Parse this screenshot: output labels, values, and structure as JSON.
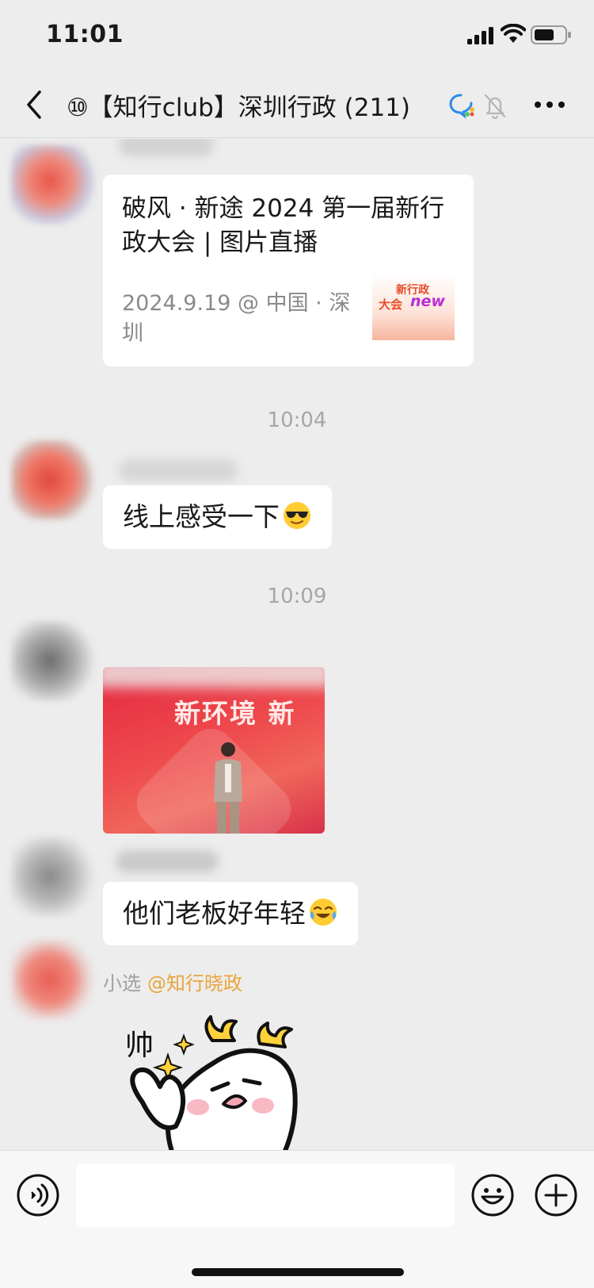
{
  "status_bar": {
    "time": "11:01"
  },
  "nav": {
    "title": "⑩【知行club】深圳行政 (211)"
  },
  "messages": {
    "card": {
      "title": "破风 · 新途 2024 第一届新行政大会 | 图片直播",
      "meta": "2024.9.19 @ 中国 · 深圳",
      "thumb_line1": "新行政",
      "thumb_line2": "大会",
      "thumb_line3": "new"
    },
    "timestamp_1": "10:04",
    "text_1": "线上感受一下",
    "timestamp_2": "10:09",
    "photo_text": "新环境 新",
    "text_2": "他们老板好年轻",
    "sender": "小选",
    "mention": "@知行晓政",
    "sticker_text": "帅"
  },
  "input": {
    "value": ""
  },
  "icons": {
    "back": "chevron-left-icon",
    "wecom": "wecom-chat-icon",
    "mute": "bell-off-icon",
    "more": "more-dots-icon",
    "voice": "voice-icon",
    "emoji": "emoji-icon",
    "plus": "plus-icon",
    "signal": "signal-icon",
    "wifi": "wifi-icon",
    "battery": "battery-icon"
  },
  "colors": {
    "background": "#ededed",
    "bubble": "#ffffff",
    "mention": "#e8a53a",
    "timestamp": "#a6a6a6"
  }
}
